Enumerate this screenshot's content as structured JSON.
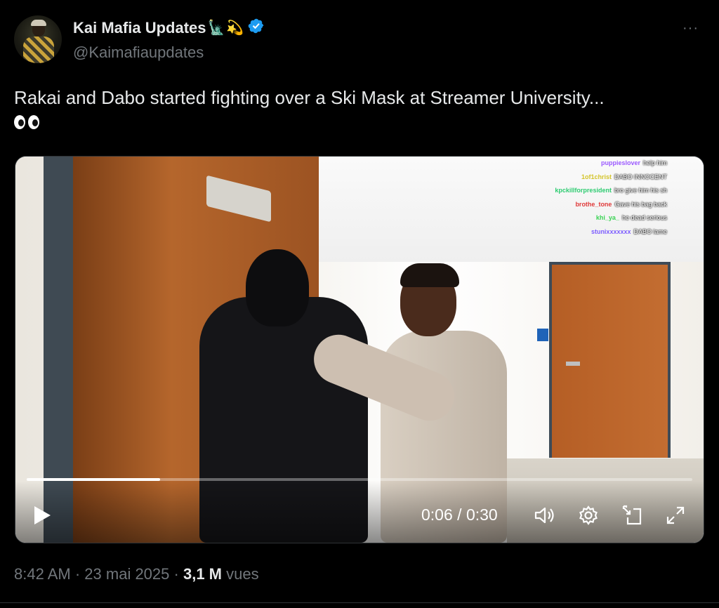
{
  "author": {
    "display_name": "Kai Mafia Updates",
    "name_emojis": [
      "🗽",
      "💫"
    ],
    "handle": "@Kaimafiaupdates",
    "verified": true,
    "more_label": "···"
  },
  "tweet": {
    "text": "Rakai and Dabo started fighting over a Ski Mask at Streamer University...",
    "trailing_emoji": "👀"
  },
  "video": {
    "current_time": "0:06",
    "separator": "/",
    "duration": "0:30",
    "progress_fraction": 0.2,
    "chat": [
      {
        "user": "",
        "message": "",
        "user_color": "#8a5cf6"
      },
      {
        "user": "puppieslover",
        "message": "help him",
        "user_color": "#9b59ff"
      },
      {
        "user": "1of1christ",
        "message": "DABO INNOCENT",
        "user_color": "#d4c42a"
      },
      {
        "user": "kpckillforpresident",
        "message": "bro give him his sh",
        "user_color": "#2ecc71"
      },
      {
        "user": "brothe_tone",
        "message": "Gave his bag back",
        "user_color": "#e03b3b"
      },
      {
        "user": "khi_ya_",
        "message": "he dead serious",
        "user_color": "#39d353"
      },
      {
        "user": "stunixxxxxxx",
        "message": "DABO lame",
        "user_color": "#7c5cff"
      }
    ],
    "controls": [
      "play-icon",
      "volume-icon",
      "settings-icon",
      "picture-in-picture-icon",
      "fullscreen-icon"
    ]
  },
  "meta": {
    "time": "8:42 AM",
    "dot1": "·",
    "date": "23 mai 2025",
    "dot2": "·",
    "views_count": "3,1 M",
    "views_label": "vues"
  },
  "colors": {
    "background": "#000000",
    "text": "#e7e9ea",
    "secondary": "#71767b",
    "verified": "#1d9bf0"
  }
}
